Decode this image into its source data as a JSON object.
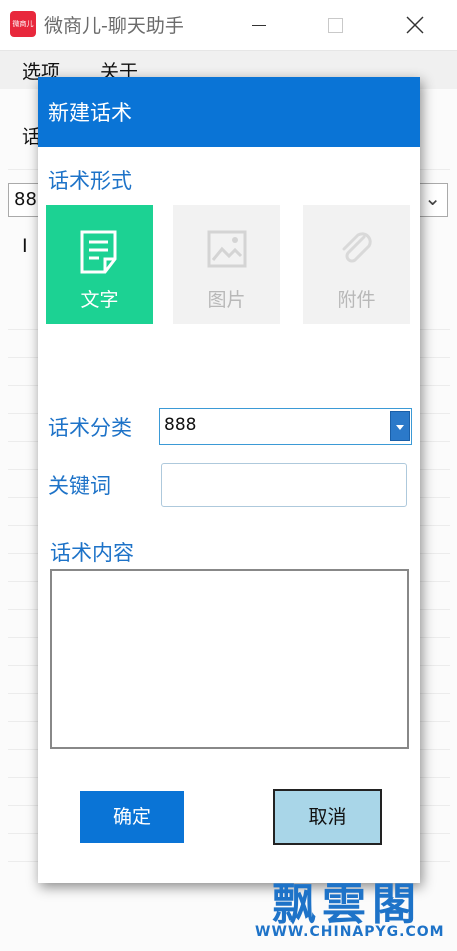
{
  "window": {
    "logo_text": "微商儿",
    "title": "微商儿-聊天助手",
    "colors": {
      "logo": "#e8283c"
    }
  },
  "menu": {
    "options": "选项",
    "about": "关于"
  },
  "background": {
    "tab_partial": "话",
    "select_partial": "88",
    "text_partial": "I"
  },
  "dialog": {
    "title": "新建话术",
    "form_label": "话术形式",
    "types": [
      {
        "label": "文字",
        "icon": "document-icon",
        "active": true
      },
      {
        "label": "图片",
        "icon": "image-icon",
        "active": false
      },
      {
        "label": "附件",
        "icon": "paperclip-icon",
        "active": false
      }
    ],
    "category_label": "话术分类",
    "category_value": "888",
    "keyword_label": "关键词",
    "keyword_value": "",
    "content_label": "话术内容",
    "content_value": "",
    "ok_label": "确定",
    "cancel_label": "取消",
    "colors": {
      "header": "#0a74d6",
      "active_type": "#1cd293",
      "label": "#1e73c8",
      "cancel_bg": "#a9d6e8"
    }
  },
  "watermark": {
    "chinese": "飘雲閣",
    "url": "WWW.CHINAPYG.COM"
  }
}
